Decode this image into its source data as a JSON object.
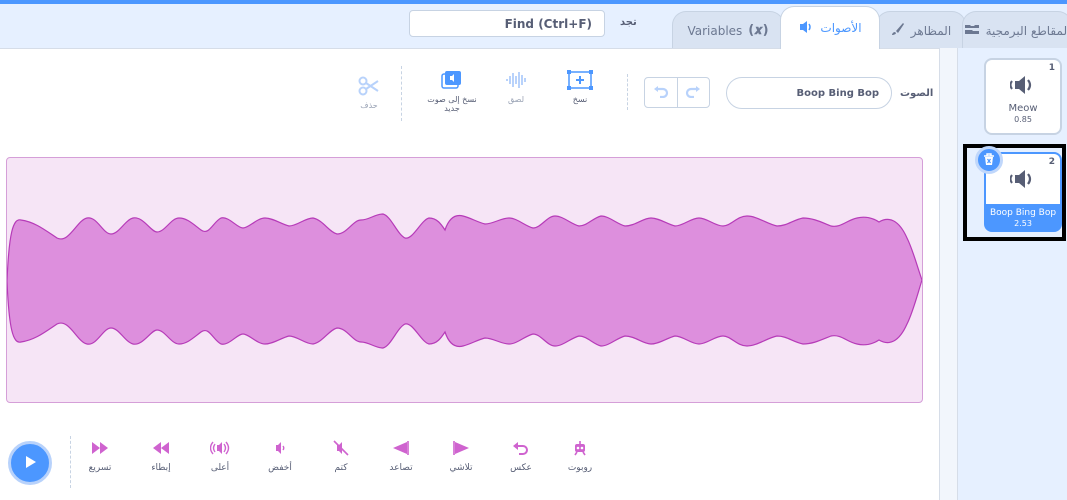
{
  "tabs": [
    {
      "label": "المقاطع البرمجية",
      "icon": "code-blocks-icon",
      "active": false
    },
    {
      "label": "المظاهر",
      "icon": "paintbrush-icon",
      "active": false
    },
    {
      "label": "الأصوات",
      "icon": "speaker-icon",
      "active": true
    },
    {
      "label": "Variables",
      "icon": "variable-x-icon",
      "active": false
    }
  ],
  "find": {
    "placeholder": "Find (Ctrl+F)",
    "label": "تجد"
  },
  "editor": {
    "sound_label": "الصوت",
    "sound_name": "Boop Bing Bop",
    "undo_icon": "undo-icon",
    "redo_icon": "redo-icon",
    "tools": {
      "copy": "نسخ",
      "paste": "لصق",
      "copy_to_new": "نسخ إلى صوت جديد",
      "delete": "حذف"
    }
  },
  "effects": [
    {
      "label": "تسريع",
      "icon": "faster-icon"
    },
    {
      "label": "إبطاء",
      "icon": "slower-icon"
    },
    {
      "label": "أعلى",
      "icon": "louder-icon"
    },
    {
      "label": "أخفض",
      "icon": "softer-icon"
    },
    {
      "label": "كتم",
      "icon": "mute-icon"
    },
    {
      "label": "تصاعد",
      "icon": "fade-in-icon"
    },
    {
      "label": "تلاشي",
      "icon": "fade-out-icon"
    },
    {
      "label": "عكس",
      "icon": "reverse-icon"
    },
    {
      "label": "روبوت",
      "icon": "robot-icon"
    }
  ],
  "sounds": [
    {
      "number": "1",
      "name": "Meow",
      "duration": "0.85",
      "selected": false
    },
    {
      "number": "2",
      "name": "Boop Bing Bop",
      "duration": "2.53",
      "selected": true
    }
  ],
  "colors": {
    "accent": "#4c97ff",
    "wave_fill": "#dd8fdd",
    "wave_stroke": "#b63bb8",
    "wave_bg": "#f6e5f6"
  }
}
